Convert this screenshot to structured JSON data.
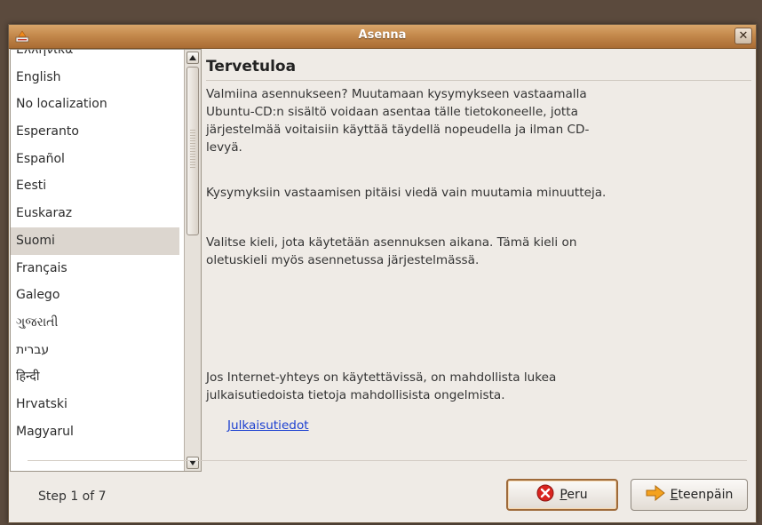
{
  "window": {
    "title": "Asenna",
    "close_glyph": "✕"
  },
  "languages": {
    "items": [
      "Ελληνικά",
      "English",
      "No localization",
      "Esperanto",
      "Español",
      "Eesti",
      "Euskaraz",
      "Suomi",
      "Français",
      "Galego",
      "ગુજરાતી",
      "עברית",
      "हिन्दी",
      "Hrvatski",
      "Magyarul"
    ],
    "selected": "Suomi"
  },
  "content": {
    "heading": "Tervetuloa",
    "paragraph1": "Valmiina asennukseen? Muutamaan kysymykseen vastaamalla Ubuntu-CD:n sisältö voidaan asentaa tälle tietokoneelle, jotta järjestelmää voitaisiin käyttää täydellä nopeudella ja ilman CD-levyä.",
    "paragraph2": "Kysymyksiin vastaamisen pitäisi viedä vain muutamia minuutteja.",
    "paragraph3": "Valitse kieli, jota käytetään asennuksen aikana. Tämä kieli on oletuskieli myös asennetussa järjestelmässä.",
    "paragraph4": "Jos Internet-yhteys on käytettävissä, on mahdollista lukea julkaisutiedoista tietoja mahdollisista ongelmista.",
    "release_notes_link": "Julkaisutiedot"
  },
  "footer": {
    "step_text": "Step 1 of 7",
    "cancel_label": "Peru",
    "next_label": "Eteenpäin"
  },
  "colors": {
    "titlebar": "#c4894c",
    "selection": "#dcd6cf",
    "link": "#1b3fd0"
  }
}
